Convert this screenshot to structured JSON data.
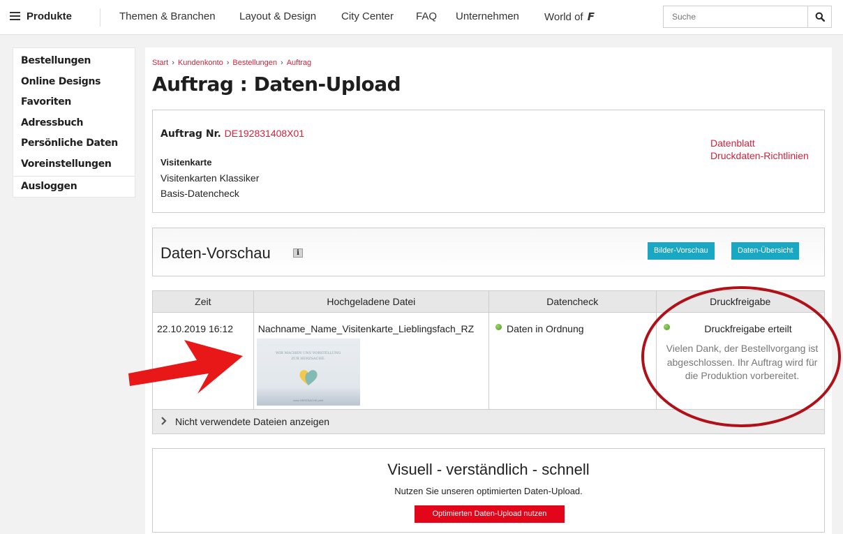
{
  "nav": {
    "produkte": "Produkte",
    "items": [
      "Themen & Branchen",
      "Layout & Design",
      "City Center",
      "FAQ",
      "Unternehmen",
      "World of"
    ],
    "world_of_logo": "F",
    "search_placeholder": "Suche"
  },
  "sidebar": {
    "items": [
      "Bestellungen",
      "Online Designs",
      "Favoriten",
      "Adressbuch",
      "Persönliche Daten",
      "Voreinstellungen"
    ],
    "logout": "Ausloggen"
  },
  "breadcrumb": [
    "Start",
    "Kundenkonto",
    "Bestellungen",
    "Auftrag"
  ],
  "page_title": "Auftrag : Daten-Upload",
  "order": {
    "number_label": "Auftrag Nr.",
    "number": "DE192831408X01",
    "product": "Visitenkarte",
    "variant": "Visitenkarten Klassiker",
    "check": "Basis-Datencheck",
    "links": [
      "Datenblatt",
      "Druckdaten-Richtlinien"
    ]
  },
  "preview": {
    "title": "Daten-Vorschau",
    "info_icon": "i",
    "buttons": [
      "Bilder-Vorschau",
      "Daten-Übersicht"
    ]
  },
  "table": {
    "headers": [
      "Zeit",
      "Hochgeladene Datei",
      "Datencheck",
      "Druckfreigabe"
    ],
    "row": {
      "time": "22.10.2019 16:12",
      "file": "Nachname_Name_Visitenkarte_Lieblingsfach_RZ",
      "thumb_lines": [
        "WIR MACHEN UNS VORSTELLUNG",
        "ZUR HERZSACHE."
      ],
      "thumb_footer": "www.HERZSACHE.print",
      "datacheck": "Daten in Ordnung",
      "release_title": "Druckfreigabe erteilt",
      "release_text": "Vielen Dank, der Bestellvorgang ist abgeschlossen. Ihr Auftrag wird für die Produktion vorbereitet."
    },
    "unused": "Nicht verwendete Dateien anzeigen"
  },
  "promo": {
    "title": "Visuell - verständlich - schnell",
    "subtitle": "Nutzen Sie unseren optimierten Daten-Upload.",
    "button": "Optimierten Daten-Upload nutzen"
  },
  "colors": {
    "accent_red": "#d6213a",
    "button_blue": "#1aa7c4",
    "button_red": "#e3061b",
    "annotation_red": "#b01018",
    "status_green": "#5aa820"
  }
}
